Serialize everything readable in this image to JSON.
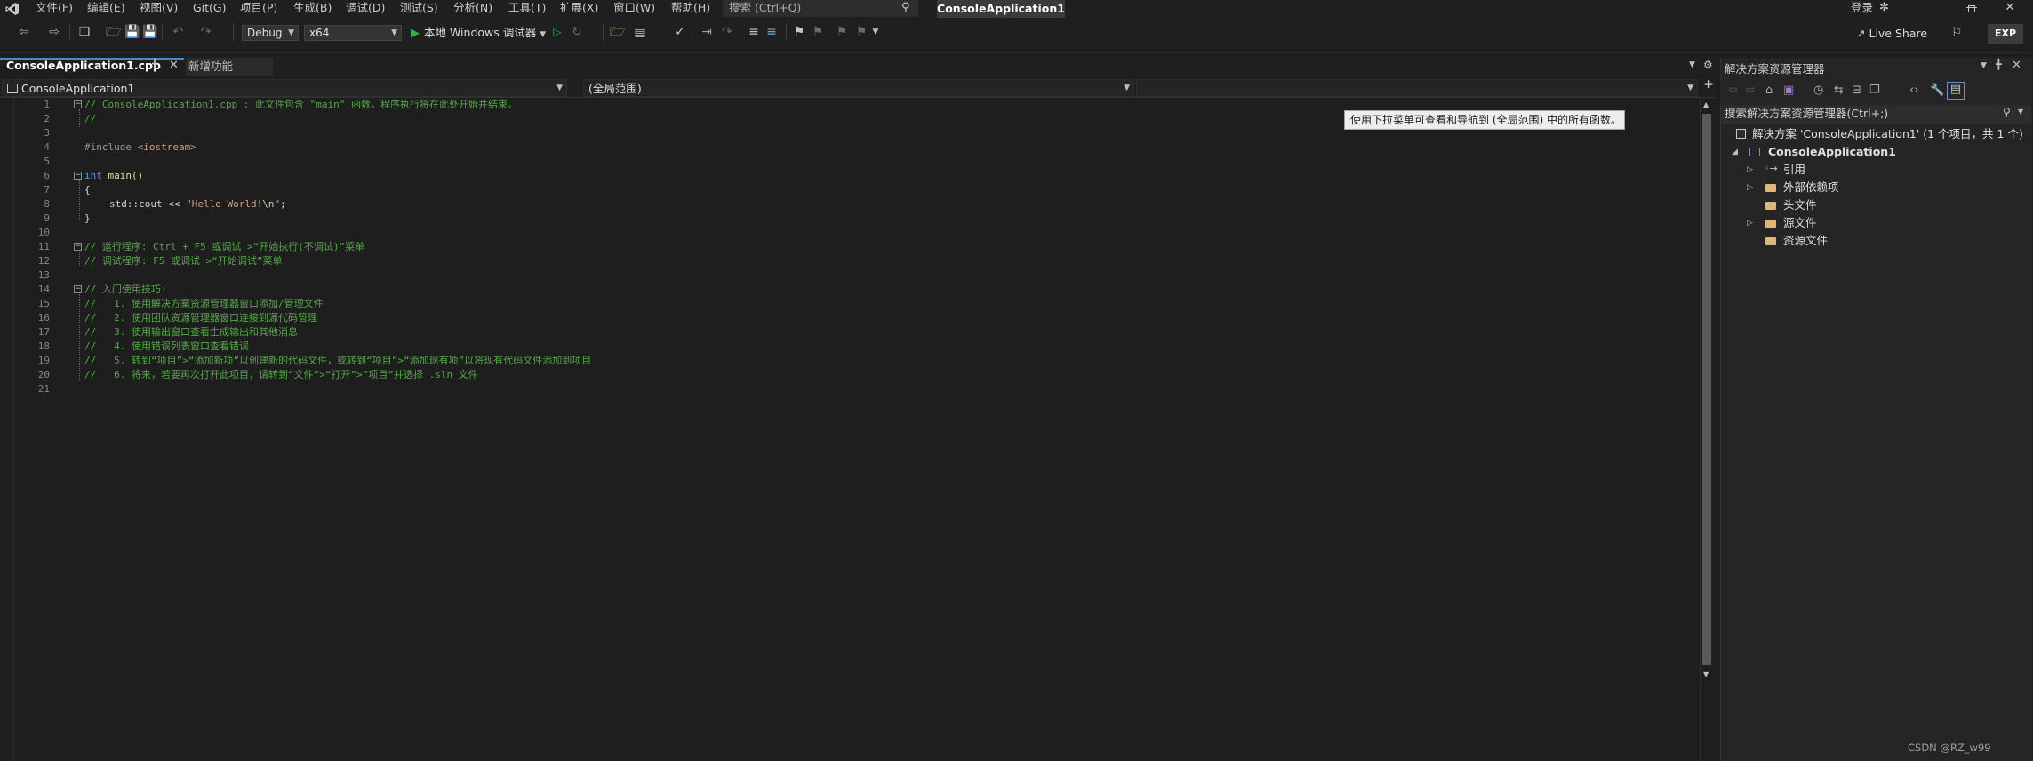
{
  "menubar": {
    "items": [
      "文件(F)",
      "编辑(E)",
      "视图(V)",
      "Git(G)",
      "项目(P)",
      "生成(B)",
      "调试(D)",
      "测试(S)",
      "分析(N)",
      "工具(T)",
      "扩展(X)",
      "窗口(W)",
      "帮助(H)"
    ],
    "search_placeholder": "搜索 (Ctrl+Q)",
    "project_title": "ConsoleApplication1",
    "login_label": "登录"
  },
  "toolbar": {
    "config": "Debug",
    "platform": "x64",
    "run_label": "本地 Windows 调试器",
    "live_share": "Live Share",
    "exp_badge": "EXP"
  },
  "tabs": [
    {
      "label": "ConsoleApplication1.cpp",
      "active": true
    },
    {
      "label": "新增功能",
      "active": false
    }
  ],
  "navbar": {
    "project": "ConsoleApplication1",
    "scope": "(全局范围)",
    "member": ""
  },
  "editor": {
    "line_numbers": [
      "1",
      "2",
      "3",
      "4",
      "5",
      "6",
      "7",
      "8",
      "9",
      "10",
      "11",
      "12",
      "13",
      "14",
      "15",
      "16",
      "17",
      "18",
      "19",
      "20",
      "21"
    ],
    "lines": {
      "l1": "// ConsoleApplication1.cpp : 此文件包含 \"main\" 函数。程序执行将在此处开始并结束。",
      "l2": "//",
      "l4a": "#include ",
      "l4b": "<iostream>",
      "l6a": "int",
      "l6b": " main()",
      "l7": "{",
      "l8a": "std::cout << ",
      "l8b": "\"Hello World!",
      "l8c": "\\n",
      "l8d": "\"",
      "l8e": ";",
      "l9": "}",
      "l11": "// 运行程序: Ctrl + F5 或调试 >“开始执行(不调试)”菜单",
      "l12": "// 调试程序: F5 或调试 >“开始调试”菜单",
      "l14": "// 入门使用技巧:",
      "l15": "//   1. 使用解决方案资源管理器窗口添加/管理文件",
      "l16": "//   2. 使用团队资源管理器窗口连接到源代码管理",
      "l17": "//   3. 使用输出窗口查看生成输出和其他消息",
      "l18": "//   4. 使用错误列表窗口查看错误",
      "l19": "//   5. 转到“项目”>“添加新项”以创建新的代码文件，或转到“项目”>“添加现有项”以将现有代码文件添加到项目",
      "l20": "//   6. 将来，若要再次打开此项目，请转到“文件”>“打开”>“项目”并选择 .sln 文件"
    },
    "tooltip": "使用下拉菜单可查看和导航到 (全局范围) 中的所有函数。"
  },
  "solution_explorer": {
    "title": "解决方案资源管理器",
    "search_placeholder": "搜索解决方案资源管理器(Ctrl+;)",
    "solution": "解决方案 'ConsoleApplication1' (1 个项目，共 1 个)",
    "project": "ConsoleApplication1",
    "nodes": [
      "引用",
      "外部依赖项",
      "头文件",
      "源文件",
      "资源文件"
    ]
  },
  "watermark": "CSDN @RZ_w99"
}
